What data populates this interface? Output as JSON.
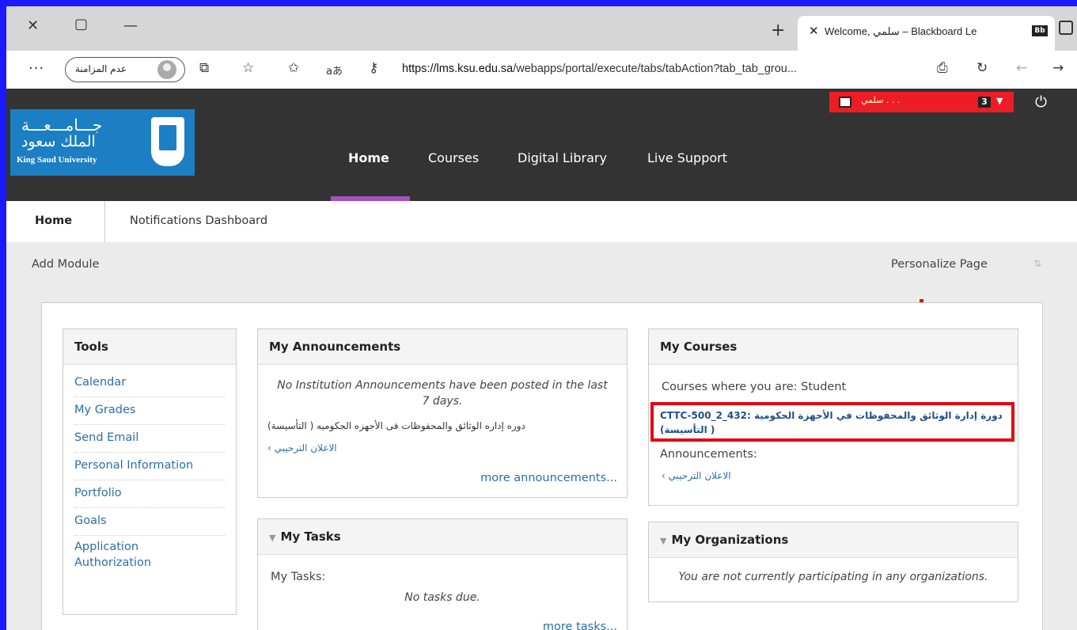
{
  "browser": {
    "tab_title": "Welcome, سلمي – Blackboard Le",
    "tab_badge": "Bb",
    "profile_label": "عدم المزامنة",
    "url_domain": "https://lms.ksu.edu.sa",
    "url_path": "/webapps/portal/execute/tabs/tabAction?tab_tab_grou...",
    "reader_icon_text": "aあ"
  },
  "header": {
    "logo_arabic_1": "جـــامـــعـــة",
    "logo_arabic_2": "الملك سعود",
    "logo_english": "King Saud University",
    "nav": [
      "Home",
      "Courses",
      "Digital Library",
      "Live Support"
    ],
    "user_name": "سلمي . . .",
    "notification_count": "3"
  },
  "tabs": {
    "home": "Home",
    "notifications": "Notifications Dashboard"
  },
  "toolbar": {
    "add_module": "Add Module",
    "personalize": "Personalize Page"
  },
  "tools": {
    "title": "Tools",
    "items": [
      "Calendar",
      "My Grades",
      "Send Email",
      "Personal Information",
      "Portfolio",
      "Goals",
      "Application Authorization"
    ]
  },
  "announcements": {
    "title": "My Announcements",
    "none_text": "No Institution Announcements have been posted in the last 7 days.",
    "course_name": "دوره إداره الوثائق والمحفوظات فى الأجهزه الحكوميه ( التأسيسة)",
    "item": "الاعلان الترحيبي",
    "more": "more announcements..."
  },
  "tasks": {
    "title": "My Tasks",
    "label": "My Tasks:",
    "none": "No tasks due.",
    "more": "more tasks..."
  },
  "courses": {
    "title": "My Courses",
    "role_text": "Courses where you are: Student",
    "course_link": "CTTC-500_2_432: دورة إدارة الوثائق والمحفوظات في الأجهزة الحكومية ( التأسيسة)",
    "announcements_label": "Announcements:",
    "announcement_item": "الاعلان الترحيبي",
    "highlight_color": "#e30613"
  },
  "organizations": {
    "title": "My Organizations",
    "none": "You are not currently participating in any organizations."
  }
}
